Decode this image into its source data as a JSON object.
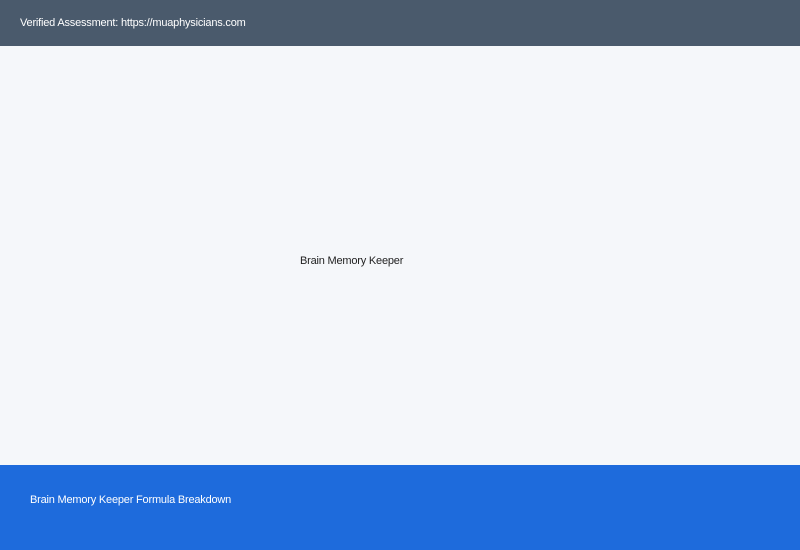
{
  "header": {
    "verified_text": "Verified Assessment: https://muaphysicians.com"
  },
  "main": {
    "image_alt_text": "Brain Memory Keeper"
  },
  "footer_banner": {
    "link_text": "Brain Memory Keeper Formula Breakdown"
  },
  "colors": {
    "header_bg": "#4a5a6c",
    "page_bg": "#f5f7fa",
    "banner_bg": "#1e6bdc"
  }
}
